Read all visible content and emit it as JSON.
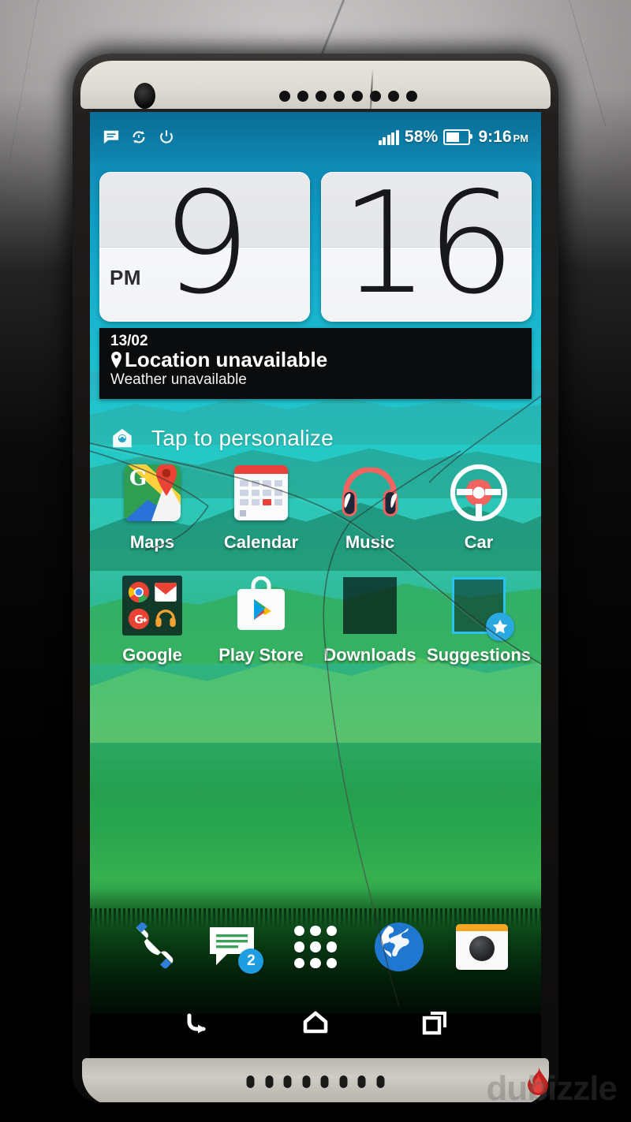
{
  "device": {
    "type": "smartphone-home-screen",
    "front_camera_icon": "front-camera",
    "earpiece_icon": "earpiece-speaker"
  },
  "statusbar": {
    "left_icons": [
      "message-icon",
      "sync-icon",
      "power-saver-icon"
    ],
    "signal_icon": "signal-bars-icon",
    "battery_percent": "58%",
    "battery_icon": "battery-icon",
    "time": "9:16",
    "time_meridiem": "PM"
  },
  "clock_widget": {
    "hour": "9",
    "minute": "16",
    "meridiem": "PM"
  },
  "weather_widget": {
    "date": "13/02",
    "location": "Location unavailable",
    "location_icon": "location-pin-icon",
    "condition": "Weather unavailable"
  },
  "personalize": {
    "icon": "blinkfeed-home-icon",
    "label": "Tap to personalize"
  },
  "apps": {
    "rows": [
      [
        {
          "label": "Maps",
          "icon": "google-maps-icon"
        },
        {
          "label": "Calendar",
          "icon": "calendar-icon"
        },
        {
          "label": "Music",
          "icon": "headphones-music-icon"
        },
        {
          "label": "Car",
          "icon": "steering-wheel-car-icon"
        }
      ],
      [
        {
          "label": "Google",
          "icon": "google-folder-icon"
        },
        {
          "label": "Play Store",
          "icon": "play-store-icon"
        },
        {
          "label": "Downloads",
          "icon": "downloads-icon"
        },
        {
          "label": "Suggestions",
          "icon": "suggestions-icon"
        }
      ]
    ],
    "folder_contents": [
      "chrome-icon",
      "gmail-icon",
      "google-plus-icon",
      "play-music-icon"
    ],
    "suggestions_badge_icon": "star-badge-icon"
  },
  "dock": {
    "items": [
      {
        "icon": "phone-icon",
        "label": "Phone"
      },
      {
        "icon": "messages-icon",
        "label": "Messages",
        "badge": "2"
      },
      {
        "icon": "app-drawer-icon",
        "label": "All apps"
      },
      {
        "icon": "browser-globe-icon",
        "label": "Internet"
      },
      {
        "icon": "camera-icon",
        "label": "Camera"
      }
    ]
  },
  "navbar": {
    "buttons": [
      {
        "icon": "back-icon",
        "label": "Back"
      },
      {
        "icon": "home-icon",
        "label": "Home"
      },
      {
        "icon": "recents-icon",
        "label": "Recent apps"
      }
    ]
  },
  "watermark": {
    "text": "dubizzle",
    "logo_icon": "flame-logo-icon"
  },
  "colors": {
    "status_bar": "#0b7ba5",
    "accent_blue": "#29c3f3",
    "wallpaper_sky": "#16b2cf",
    "wallpaper_hills": "#2aa64f",
    "badge_blue": "#1e9de3"
  }
}
